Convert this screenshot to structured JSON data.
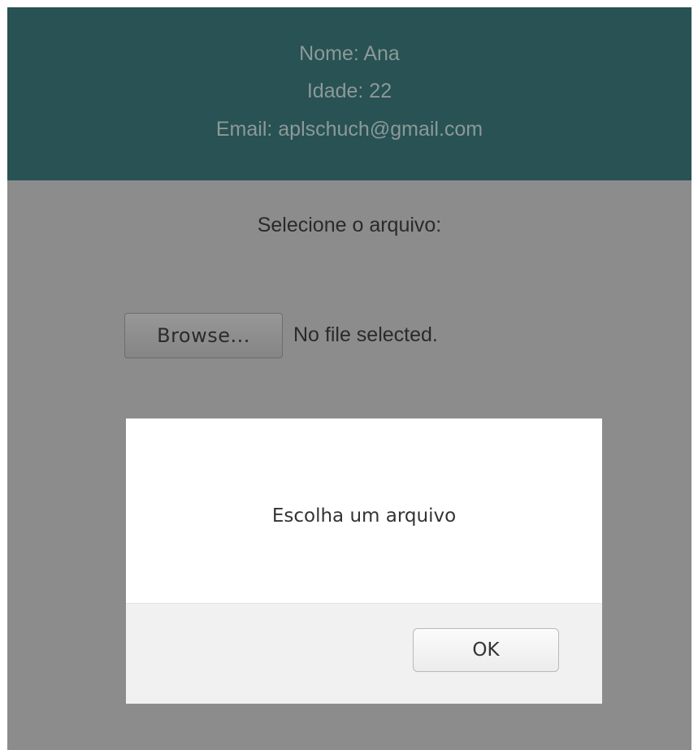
{
  "header": {
    "name_line": "Nome: Ana",
    "age_line": "Idade: 22",
    "email_line": "Email: aplschuch@gmail.com"
  },
  "upload": {
    "prompt": "Selecione o arquivo:",
    "browse_label": "Browse...",
    "file_status": "No file selected."
  },
  "dialog": {
    "message": "Escolha um arquivo",
    "ok_label": "OK"
  },
  "colors": {
    "header_bg": "#285254",
    "overlay_bg": "#8c8c8c",
    "dialog_bg": "#ffffff",
    "dialog_footer_bg": "#f1f1f1"
  }
}
